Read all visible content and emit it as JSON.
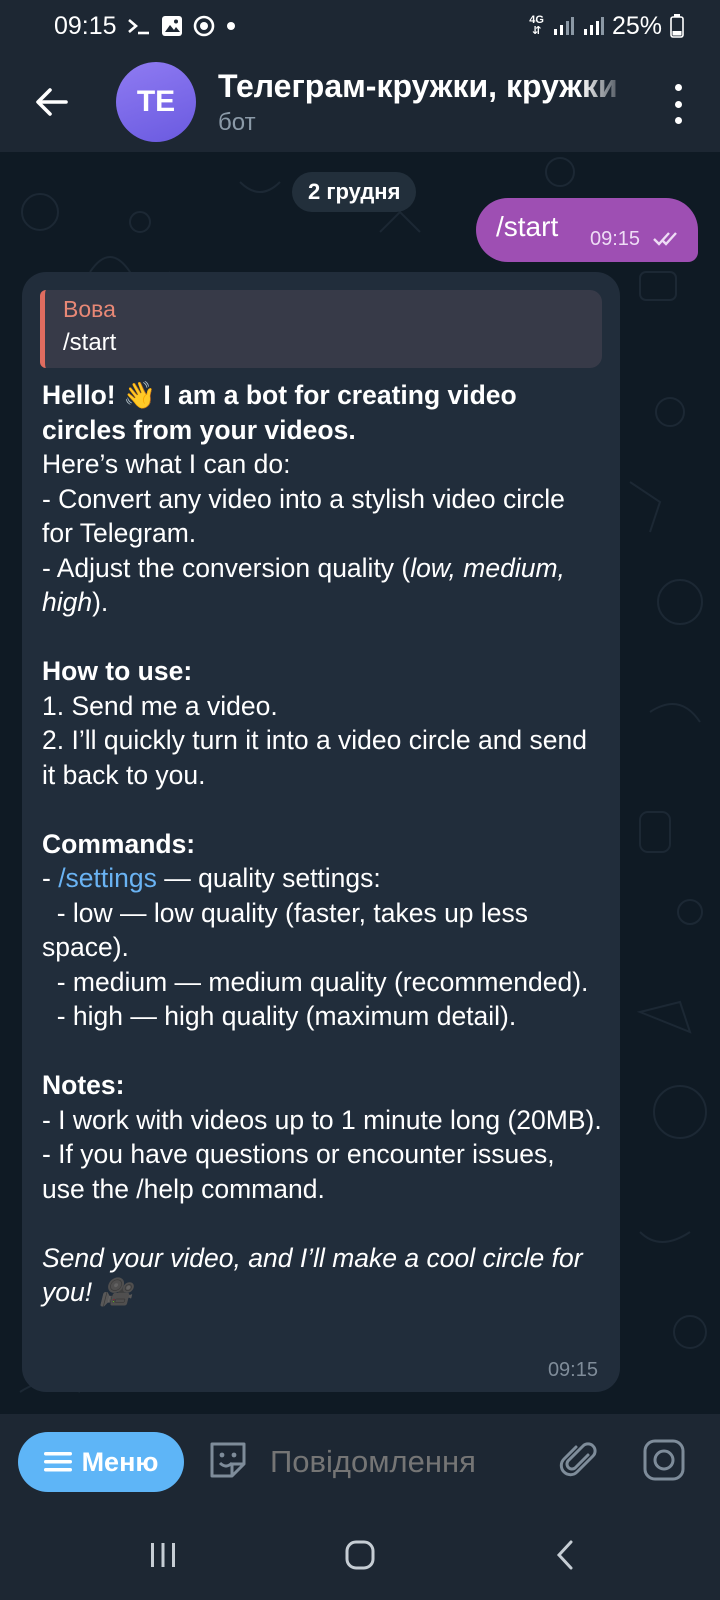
{
  "status_bar": {
    "time": "09:15",
    "network": "4G",
    "battery": "25%",
    "icons": [
      "terminal-icon",
      "image-icon",
      "record-icon",
      "dot-icon",
      "signal-icon",
      "signal-icon",
      "battery-icon"
    ]
  },
  "header": {
    "avatar_initials": "TE",
    "title": "Телеграм-кружки, кружки",
    "subtitle": "бот",
    "avatar_color": "#7b68ee"
  },
  "chat": {
    "date_label": "2 грудня",
    "outgoing": {
      "text": "/start",
      "time": "09:15",
      "bubble_color": "#9e4fb3"
    },
    "incoming": {
      "reply_name": "Вова",
      "reply_text": "/start",
      "time": "09:15",
      "lines": {
        "l1_bold": "Hello! 👋 I am a bot for creating video circles from your videos.",
        "l2": "Here’s what I can do:",
        "l3": "- Convert any video into a stylish video circle for Telegram.",
        "l4_pre": "- Adjust the conversion quality (",
        "l4_italic": "low, medium, high",
        "l4_post": ").",
        "h_use": "How to use:",
        "use1": "1. Send me a video.",
        "use2": "2. I’ll quickly turn it into a video circle and send it back to you.",
        "h_cmd": "Commands:",
        "cmd_pre": "- ",
        "cmd_link": "/settings",
        "cmd_post": " — quality settings:",
        "q_low": "  - low — low quality (faster, takes up less space).",
        "q_medium": "  - medium — medium quality (recommended).",
        "q_high": "  - high — high quality (maximum detail).",
        "h_notes": "Notes:",
        "note1": "- I work with videos up to 1 minute long (20MB).",
        "note2": "- If you have questions or encounter issues, use the /help command.",
        "outro": "Send your video, and I’ll make a cool circle for you! 🎥"
      }
    }
  },
  "input_bar": {
    "menu_label": "Меню",
    "placeholder": "Повідомлення",
    "accent": "#5eb5f7"
  },
  "nav_bar": {
    "items": [
      "recents-icon",
      "home-icon",
      "back-icon"
    ]
  }
}
